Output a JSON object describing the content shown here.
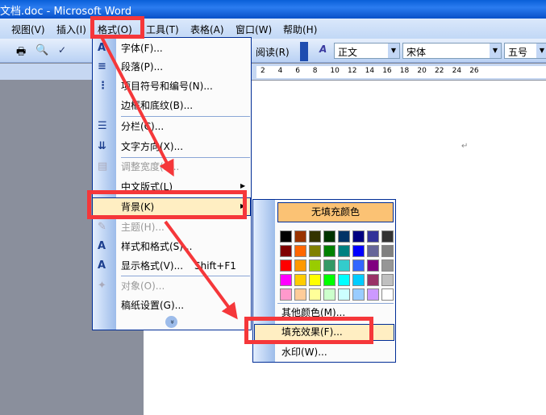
{
  "title": "文档.doc - Microsoft Word",
  "menu": [
    "视图(V)",
    "插入(I)",
    "格式(O)",
    "工具(T)",
    "表格(A)",
    "窗口(W)",
    "帮助(H)"
  ],
  "toolbar": {
    "reading": "阅读(R)",
    "style": "正文",
    "font": "宋体",
    "size": "五号"
  },
  "ruler": [
    "2",
    "4",
    "6",
    "8",
    "10",
    "12",
    "14",
    "16",
    "18",
    "20",
    "22",
    "24",
    "26"
  ],
  "format_menu": [
    {
      "label": "字体(F)...",
      "icon": "font-icon",
      "disabled": false
    },
    {
      "label": "段落(P)...",
      "icon": "paragraph-icon",
      "disabled": false
    },
    {
      "label": "项目符号和编号(N)...",
      "icon": "bullets-icon",
      "disabled": false
    },
    {
      "label": "边框和底纹(B)...",
      "icon": "",
      "disabled": false
    },
    {
      "label": "分栏(C)...",
      "icon": "columns-icon",
      "disabled": false
    },
    {
      "label": "文字方向(X)...",
      "icon": "text-direction-icon",
      "disabled": false
    },
    {
      "label": "调整宽度(I)...",
      "icon": "fit-width-icon",
      "disabled": true
    },
    {
      "label": "中文版式(L)",
      "icon": "",
      "disabled": false,
      "submenu": true
    },
    {
      "label": "背景(K)",
      "icon": "",
      "disabled": false,
      "submenu": true,
      "highlighted": true
    },
    {
      "label": "主题(H)...",
      "icon": "theme-icon",
      "disabled": true
    },
    {
      "label": "样式和格式(S)...",
      "icon": "styles-icon",
      "disabled": false
    },
    {
      "label": "显示格式(V)...",
      "icon": "reveal-formatting-icon",
      "disabled": false,
      "shortcut": "Shift+F1"
    },
    {
      "label": "对象(O)...",
      "icon": "object-icon",
      "disabled": true
    },
    {
      "label": "稿纸设置(G)...",
      "icon": "",
      "disabled": false
    }
  ],
  "background_menu": {
    "no_fill": "无填充颜色",
    "colors": [
      "#000000",
      "#993300",
      "#333300",
      "#003300",
      "#003366",
      "#000080",
      "#333399",
      "#333333",
      "#800000",
      "#FF6600",
      "#808000",
      "#008000",
      "#008080",
      "#0000FF",
      "#666699",
      "#808080",
      "#FF0000",
      "#FF9900",
      "#99CC00",
      "#339966",
      "#33CCCC",
      "#3366FF",
      "#800080",
      "#969696",
      "#FF00FF",
      "#FFCC00",
      "#FFFF00",
      "#00FF00",
      "#00FFFF",
      "#00CCFF",
      "#993366",
      "#C0C0C0",
      "#FF99CC",
      "#FFCC99",
      "#FFFF99",
      "#CCFFCC",
      "#CCFFFF",
      "#99CCFF",
      "#CC99FF",
      "#FFFFFF"
    ],
    "more_colors": "其他颜色(M)...",
    "fill_effects": "填充效果(F)...",
    "watermark": "水印(W)..."
  },
  "annotation_color": "#f5373a"
}
